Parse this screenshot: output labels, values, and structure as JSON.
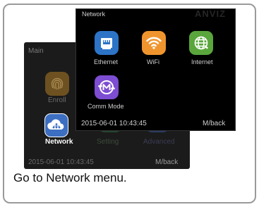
{
  "back_screen": {
    "title": "Main",
    "items": [
      {
        "label": "Enroll",
        "icon": "fingerprint-icon"
      },
      {
        "label": "Network",
        "icon": "cloud-network-icon"
      },
      {
        "label": "Setting",
        "icon": "setting-icon"
      },
      {
        "label": "Advanced",
        "icon": "advanced-icon"
      }
    ],
    "datetime": "2015-06-01 10:43:45",
    "back_hint": "M/back"
  },
  "front_screen": {
    "title": "Network",
    "brand": "ANVIZ",
    "items": [
      {
        "label": "Ethernet",
        "icon": "ethernet-icon",
        "color": "#2d74c7"
      },
      {
        "label": "WiFi",
        "icon": "wifi-icon",
        "color": "#f0952e"
      },
      {
        "label": "Internet",
        "icon": "globe-icon",
        "color": "#5aa63d"
      },
      {
        "label": "Comm Mode",
        "icon": "comm-mode-icon",
        "color": "#7d4dd2"
      }
    ],
    "datetime": "2015-06-01 10:43:45",
    "back_hint": "M/back"
  },
  "caption": "Go to Network menu."
}
